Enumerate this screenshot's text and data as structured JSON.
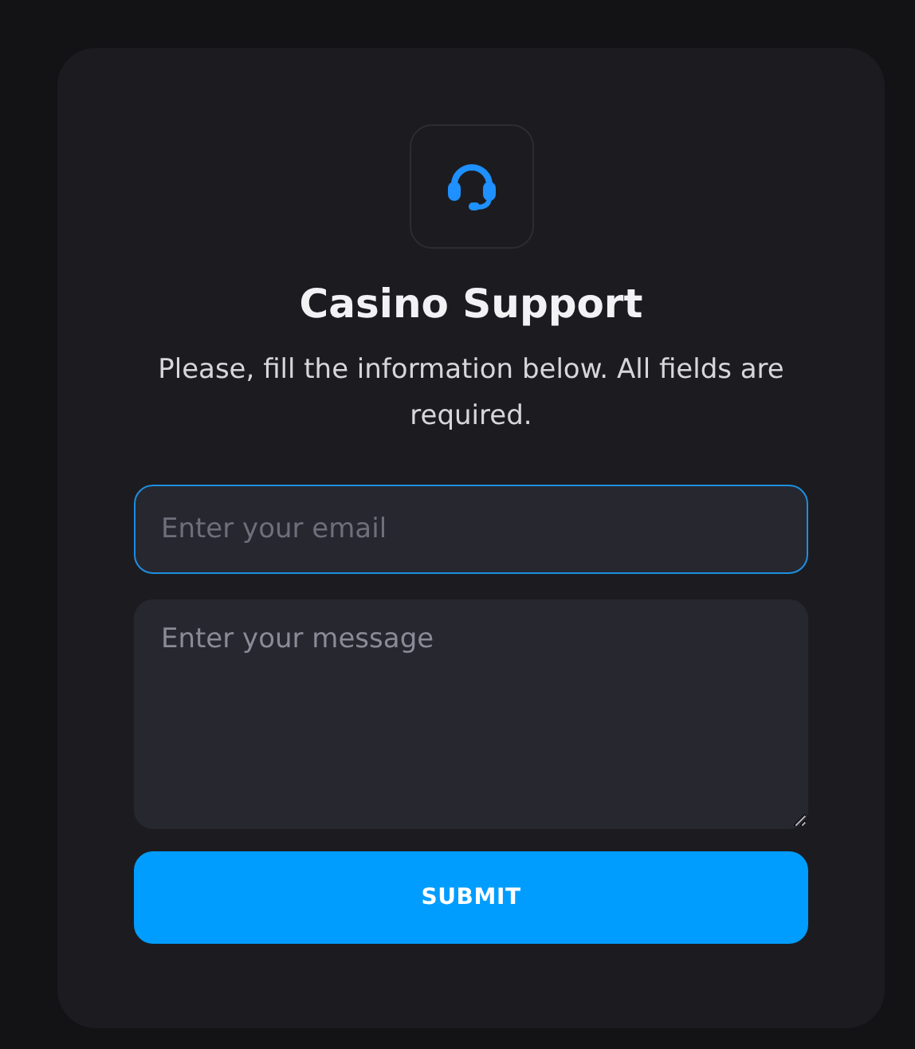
{
  "title": "Casino Support",
  "subtitle": "Please, fill the information below. All fields are required.",
  "fields": [
    {
      "kind": "input",
      "placeholder": "Enter your email",
      "focused": true
    },
    {
      "kind": "textarea",
      "placeholder": "Enter your message",
      "focused": false
    }
  ],
  "submit": {
    "label": "SUBMIT"
  }
}
